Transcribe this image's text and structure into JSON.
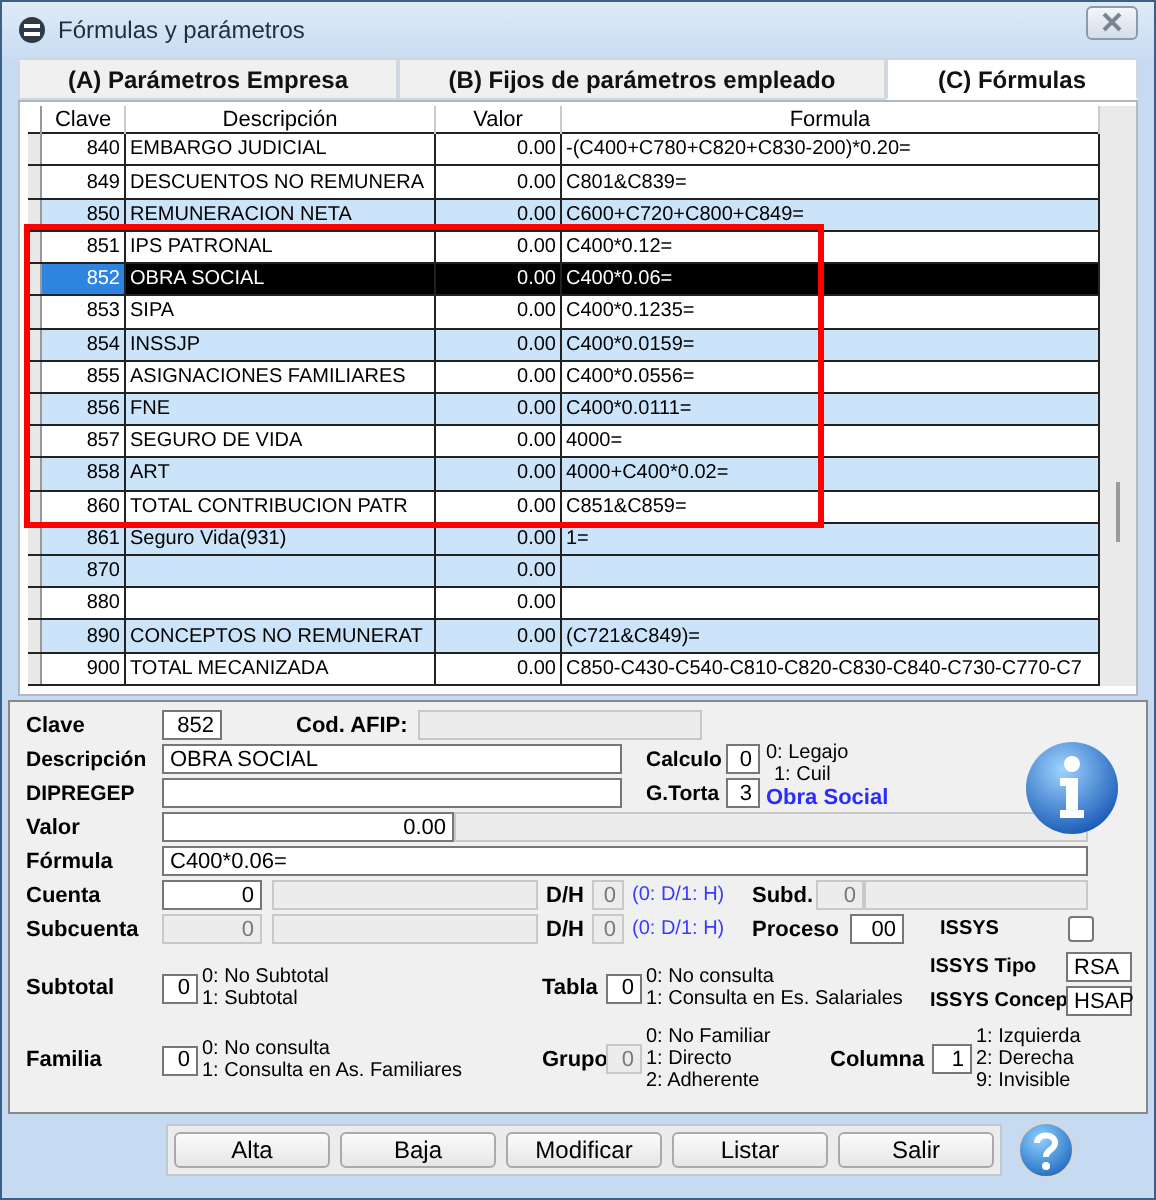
{
  "window": {
    "title": "Fórmulas y parámetros"
  },
  "tabs": [
    {
      "label": "(A) Parámetros Empresa",
      "selected": false
    },
    {
      "label": "(B) Fijos de parámetros empleado",
      "selected": false
    },
    {
      "label": "(C) Fórmulas",
      "selected": true
    }
  ],
  "table": {
    "columns": [
      "Clave",
      "Descripción",
      "Valor",
      "Formula"
    ],
    "rows": [
      {
        "clave": "840",
        "descripcion": "EMBARGO JUDICIAL",
        "valor": "0.00",
        "formula": "-(C400+C780+C820+C830-200)*0.20=",
        "selected": false,
        "shaded": false,
        "boxed": false
      },
      {
        "clave": "849",
        "descripcion": "DESCUENTOS NO REMUNERA",
        "valor": "0.00",
        "formula": "C801&C839=",
        "selected": false,
        "shaded": false,
        "boxed": false
      },
      {
        "clave": "850",
        "descripcion": "REMUNERACION NETA",
        "valor": "0.00",
        "formula": "C600+C720+C800+C849=",
        "selected": false,
        "shaded": true,
        "boxed": false
      },
      {
        "clave": "851",
        "descripcion": "IPS PATRONAL",
        "valor": "0.00",
        "formula": "C400*0.12=",
        "selected": false,
        "shaded": false,
        "boxed": true
      },
      {
        "clave": "852",
        "descripcion": "OBRA SOCIAL",
        "valor": "0.00",
        "formula": "C400*0.06=",
        "selected": true,
        "shaded": false,
        "boxed": true
      },
      {
        "clave": "853",
        "descripcion": "SIPA",
        "valor": "0.00",
        "formula": "C400*0.1235=",
        "selected": false,
        "shaded": false,
        "boxed": true
      },
      {
        "clave": "854",
        "descripcion": "INSSJP",
        "valor": "0.00",
        "formula": "C400*0.0159=",
        "selected": false,
        "shaded": true,
        "boxed": true
      },
      {
        "clave": "855",
        "descripcion": "ASIGNACIONES FAMILIARES",
        "valor": "0.00",
        "formula": "C400*0.0556=",
        "selected": false,
        "shaded": false,
        "boxed": true
      },
      {
        "clave": "856",
        "descripcion": "FNE",
        "valor": "0.00",
        "formula": "C400*0.0111=",
        "selected": false,
        "shaded": true,
        "boxed": true
      },
      {
        "clave": "857",
        "descripcion": "SEGURO DE VIDA",
        "valor": "0.00",
        "formula": "4000=",
        "selected": false,
        "shaded": false,
        "boxed": true
      },
      {
        "clave": "858",
        "descripcion": "ART",
        "valor": "0.00",
        "formula": "4000+C400*0.02=",
        "selected": false,
        "shaded": true,
        "boxed": true
      },
      {
        "clave": "860",
        "descripcion": "TOTAL CONTRIBUCION PATR",
        "valor": "0.00",
        "formula": "C851&C859=",
        "selected": false,
        "shaded": false,
        "boxed": true
      },
      {
        "clave": "861",
        "descripcion": "Seguro Vida(931)",
        "valor": "0.00",
        "formula": "1=",
        "selected": false,
        "shaded": true,
        "boxed": false
      },
      {
        "clave": "870",
        "valor": "0.00",
        "selected": false,
        "shaded": true,
        "boxed": false
      },
      {
        "clave": "880",
        "valor": "0.00",
        "selected": false,
        "shaded": false,
        "boxed": false
      },
      {
        "clave": "890",
        "descripcion": "CONCEPTOS NO REMUNERAT",
        "valor": "0.00",
        "formula": "(C721&C849)=",
        "selected": false,
        "shaded": true,
        "boxed": false
      },
      {
        "clave": "900",
        "descripcion": "TOTAL MECANIZADA",
        "valor": "0.00",
        "formula": "C850-C430-C540-C810-C820-C830-C840-C730-C770-C7",
        "selected": false,
        "shaded": false,
        "boxed": false
      }
    ]
  },
  "form": {
    "clave": {
      "label": "Clave",
      "value": "852",
      "disabled": false
    },
    "cod_afip": {
      "label": "Cod. AFIP:",
      "disabled": true
    },
    "descripcion": {
      "label": "Descripción",
      "value": "OBRA SOCIAL",
      "disabled": false
    },
    "dipregep": {
      "label": "DIPREGEP",
      "disabled": false
    },
    "calculo": {
      "label": "Calculo",
      "value": "0",
      "disabled": false,
      "options": [
        "0: Legajo",
        "1: Cuil"
      ]
    },
    "g_torta": {
      "label": "G.Torta",
      "value": "3",
      "disabled": false,
      "caption": "Obra Social"
    },
    "valor": {
      "label": "Valor",
      "value": "0.00",
      "disabled": false
    },
    "formula": {
      "label": "Fórmula",
      "value": "C400*0.06=",
      "disabled": false
    },
    "cuenta": {
      "label": "Cuenta",
      "value": "0",
      "disabled": false,
      "dh_label": "D/H",
      "dh_value": "0",
      "dh_hint": "(0: D/1: H)"
    },
    "subd": {
      "label": "Subd.",
      "value": "0",
      "disabled": true
    },
    "subcuenta": {
      "label": "Subcuenta",
      "value": "0",
      "disabled": true,
      "dh_label": "D/H",
      "dh_value": "0",
      "dh_hint": "(0: D/1: H)"
    },
    "proceso": {
      "label": "Proceso",
      "value": "00",
      "disabled": false
    },
    "issys": {
      "label": "ISSYS",
      "checked": false
    },
    "issys_tipo": {
      "label": "ISSYS Tipo",
      "value": "RSA",
      "disabled": false
    },
    "issys_concep": {
      "label": "ISSYS Concep",
      "value": "HSAP",
      "disabled": false
    },
    "subtotal": {
      "label": "Subtotal",
      "value": "0",
      "disabled": false,
      "options": [
        "0: No Subtotal",
        "1: Subtotal"
      ]
    },
    "tabla": {
      "label": "Tabla",
      "value": "0",
      "disabled": false,
      "options": [
        "0: No consulta",
        "1: Consulta en Es. Salariales"
      ]
    },
    "familia": {
      "label": "Familia",
      "value": "0",
      "disabled": false,
      "options": [
        "0: No consulta",
        "1: Consulta en As. Familiares"
      ]
    },
    "grupo": {
      "label": "Grupo",
      "value": "0",
      "disabled": true,
      "options": [
        "0: No Familiar",
        "1: Directo",
        "2: Adherente"
      ]
    },
    "columna": {
      "label": "Columna",
      "value": "1",
      "disabled": false,
      "options": [
        "1: Izquierda",
        "2: Derecha",
        "9: Invisible"
      ]
    }
  },
  "buttons": [
    "Alta",
    "Baja",
    "Modificar",
    "Listar",
    "Salir"
  ]
}
